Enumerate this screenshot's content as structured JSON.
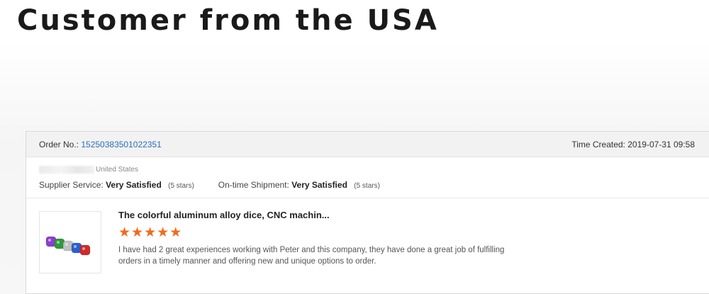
{
  "headline": "Customer from the USA",
  "order": {
    "no_label": "Order No.:",
    "no_value": "15250383501022351",
    "time_label": "Time Created:",
    "time_value": "2019-07-31 09:58"
  },
  "buyer": {
    "country": "United States"
  },
  "ratings": {
    "supplier_label": "Supplier Service:",
    "supplier_value": "Very Satisfied",
    "supplier_stars": "(5 stars)",
    "shipment_label": "On-time Shipment:",
    "shipment_value": "Very Satisfied",
    "shipment_stars": "(5 stars)"
  },
  "product": {
    "title": "The colorful aluminum alloy dice, CNC machin...",
    "star_count": 5,
    "review_line1": "I have had 2 great experiences working with Peter and this company, they have done a great job of fulfilling",
    "review_line2": "orders in a timely manner and offering new and unique options to order.",
    "die_colors": [
      "#8a3fd1",
      "#2f9a3a",
      "#c0c0c0",
      "#2b5fd0",
      "#d02a2a"
    ],
    "thumb_icon": "colorful-dice-row"
  },
  "colors": {
    "link": "#2a6ebb",
    "star": "#f26b1d"
  }
}
